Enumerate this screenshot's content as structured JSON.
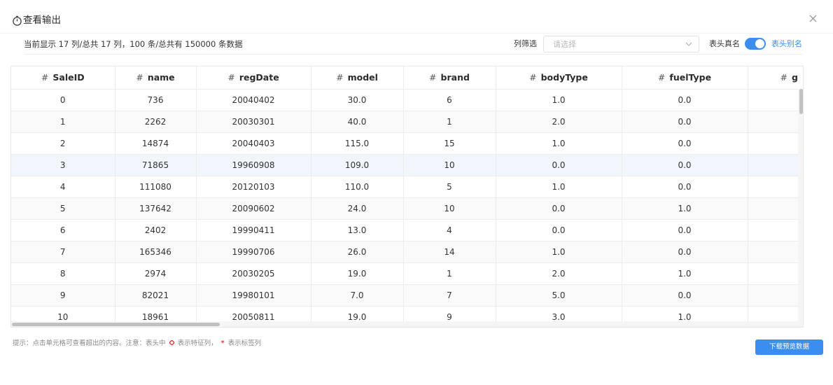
{
  "dialog": {
    "title": "查看输出",
    "title_icon": "timer-icon",
    "close_icon": "close-icon"
  },
  "summary": {
    "text": "当前显示 17 列/总共 17 列，100 条/总共有 150000 条数据"
  },
  "filter": {
    "label": "列筛选",
    "placeholder": "请选择",
    "arrow_icon": "chevron-down-icon"
  },
  "header_mode": {
    "real_name_label": "表头真名",
    "alias_label": "表头别名",
    "toggle_on": true,
    "accent_color": "#3b8ef0"
  },
  "table": {
    "hash_symbol": "#",
    "columns": [
      "SaleID",
      "name",
      "regDate",
      "model",
      "brand",
      "bodyType",
      "fuelType",
      "gea"
    ],
    "rows": [
      [
        "0",
        "736",
        "20040402",
        "30.0",
        "6",
        "1.0",
        "0.0",
        ""
      ],
      [
        "1",
        "2262",
        "20030301",
        "40.0",
        "1",
        "2.0",
        "0.0",
        ""
      ],
      [
        "2",
        "14874",
        "20040403",
        "115.0",
        "15",
        "1.0",
        "0.0",
        ""
      ],
      [
        "3",
        "71865",
        "19960908",
        "109.0",
        "10",
        "0.0",
        "0.0",
        ""
      ],
      [
        "4",
        "111080",
        "20120103",
        "110.0",
        "5",
        "1.0",
        "0.0",
        ""
      ],
      [
        "5",
        "137642",
        "20090602",
        "24.0",
        "10",
        "0.0",
        "1.0",
        ""
      ],
      [
        "6",
        "2402",
        "19990411",
        "13.0",
        "4",
        "0.0",
        "0.0",
        ""
      ],
      [
        "7",
        "165346",
        "19990706",
        "26.0",
        "14",
        "1.0",
        "0.0",
        ""
      ],
      [
        "8",
        "2974",
        "20030205",
        "19.0",
        "1",
        "2.0",
        "1.0",
        ""
      ],
      [
        "9",
        "82021",
        "19980101",
        "7.0",
        "7",
        "5.0",
        "0.0",
        ""
      ],
      [
        "10",
        "18961",
        "20050811",
        "19.0",
        "9",
        "3.0",
        "1.0",
        ""
      ]
    ]
  },
  "footer": {
    "tip_part1": "提示：点击单元格可查看超出的内容。注意：表头中",
    "tip_part2": "表示特征列，",
    "tip_star": "*",
    "tip_part3": "表示标签列",
    "feature_icon": "diamond-icon",
    "download_label": "下载预览数据"
  }
}
